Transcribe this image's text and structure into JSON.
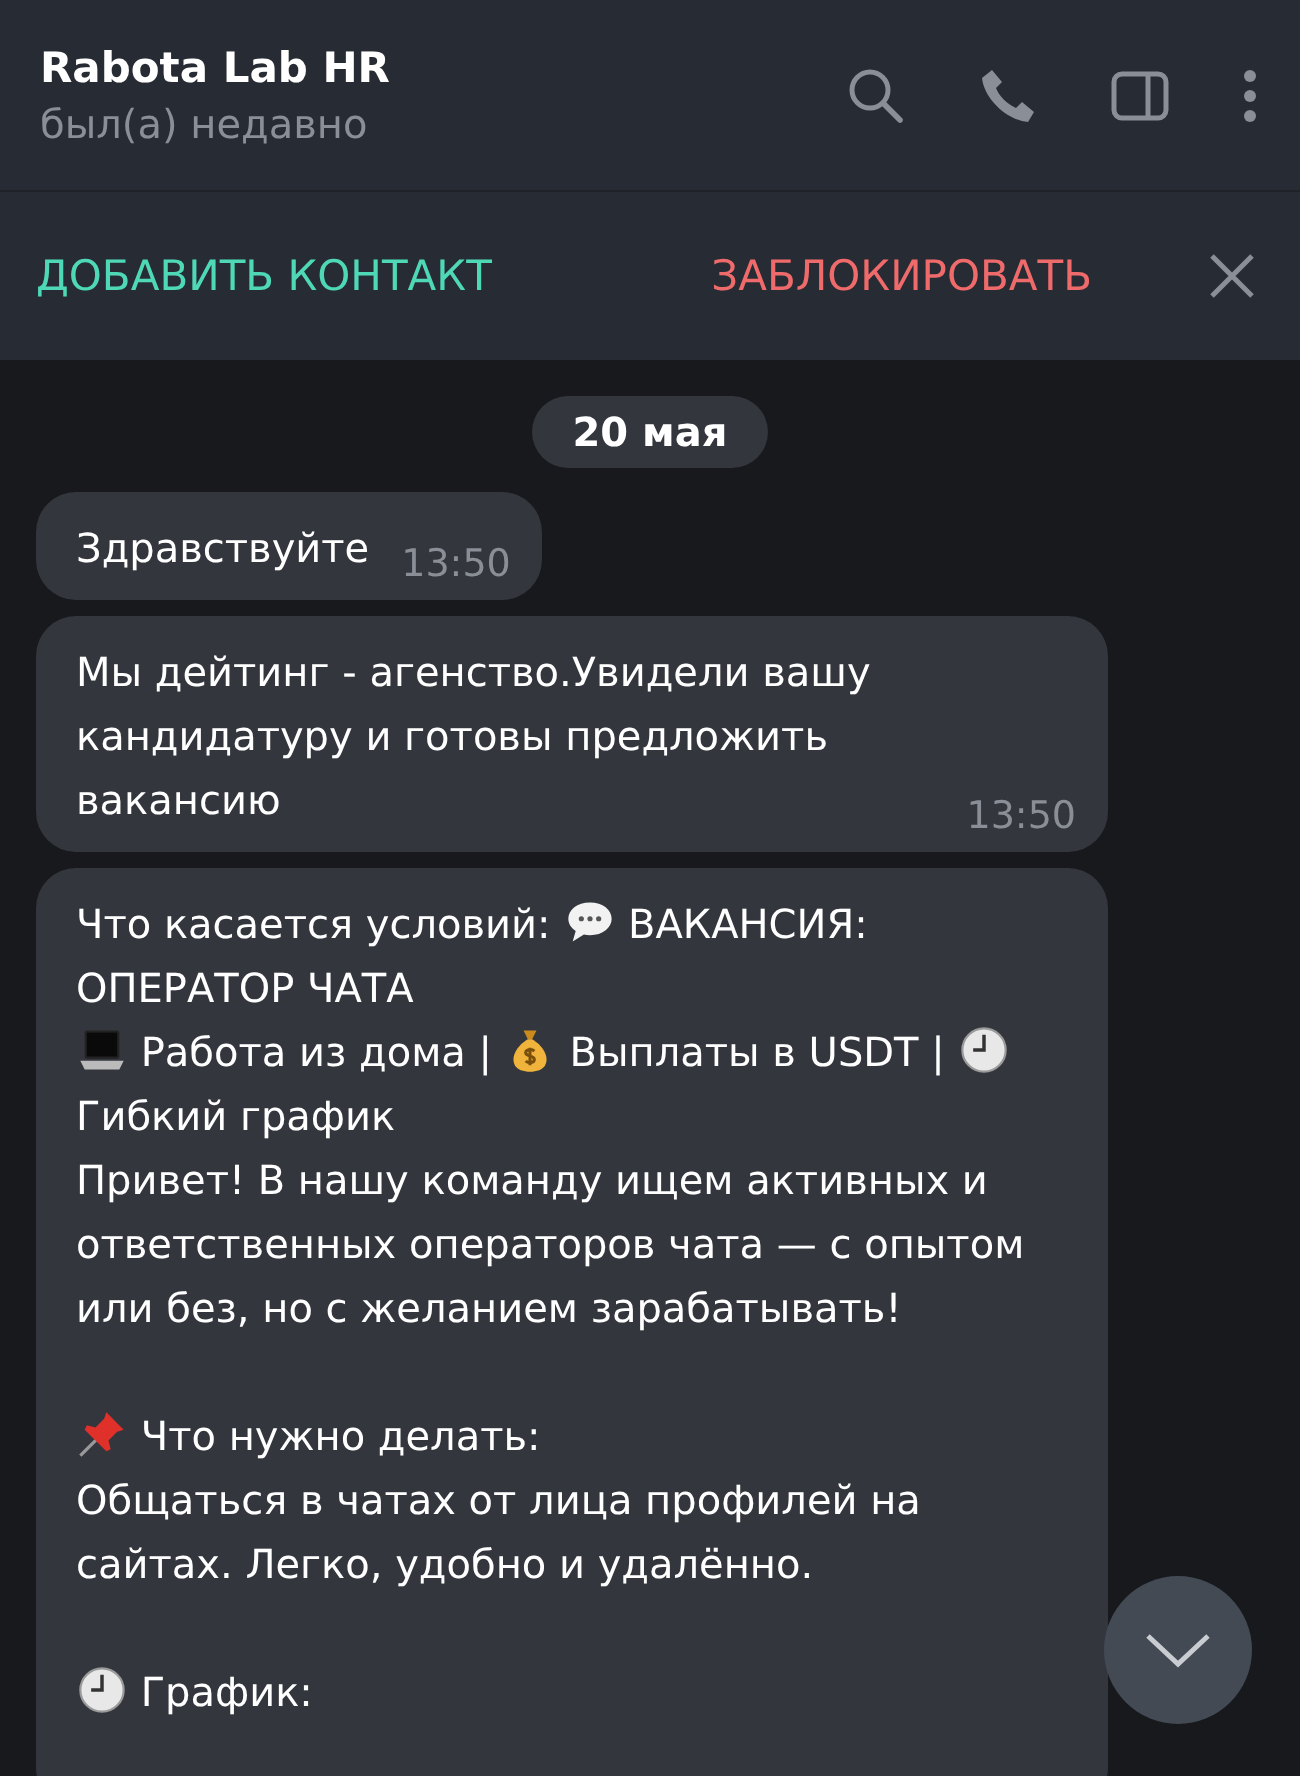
{
  "header": {
    "title": "Rabota Lab HR",
    "status": "был(а) недавно"
  },
  "action_bar": {
    "add_contact": "ДОБАВИТЬ КОНТАКТ",
    "block": "ЗАБЛОКИРОВАТЬ"
  },
  "date_badge": "20 мая",
  "messages": [
    {
      "text": "Здравствуйте",
      "time": "13:50"
    },
    {
      "text": "Мы дейтинг - агенство.Увидели вашу кандидатуру и готовы предложить вакансию",
      "time": "13:50"
    },
    {
      "blocks": [
        [
          [
            {
              "kind": "text",
              "text": "Что касается условий:"
            },
            {
              "kind": "speech"
            },
            {
              "kind": "text",
              "text": "ВАКАНСИЯ:"
            },
            {
              "kind": "text",
              "text": "ОПЕРАТОР ЧАТА"
            }
          ],
          [
            {
              "kind": "laptop"
            },
            {
              "kind": "text",
              "text": "Работа из дома |"
            },
            {
              "kind": "money"
            },
            {
              "kind": "text",
              "text": "Выплаты в USDT |"
            },
            {
              "kind": "clock"
            },
            {
              "kind": "text",
              "text": "Гибкий график"
            }
          ],
          [
            {
              "kind": "text",
              "text": "Привет! В нашу команду ищем активных и ответственных операторов чата — с опытом или без, но с желанием зарабатывать!"
            }
          ]
        ],
        [
          [
            {
              "kind": "pin"
            },
            {
              "kind": "text",
              "text": "Что нужно делать:"
            }
          ],
          [
            {
              "kind": "text",
              "text": "Общаться в чатах от лица профилей на сайтах. Легко, удобно и удалённо."
            }
          ]
        ],
        [
          [
            {
              "kind": "clock"
            },
            {
              "kind": "text",
              "text": "График:"
            }
          ]
        ]
      ]
    }
  ]
}
